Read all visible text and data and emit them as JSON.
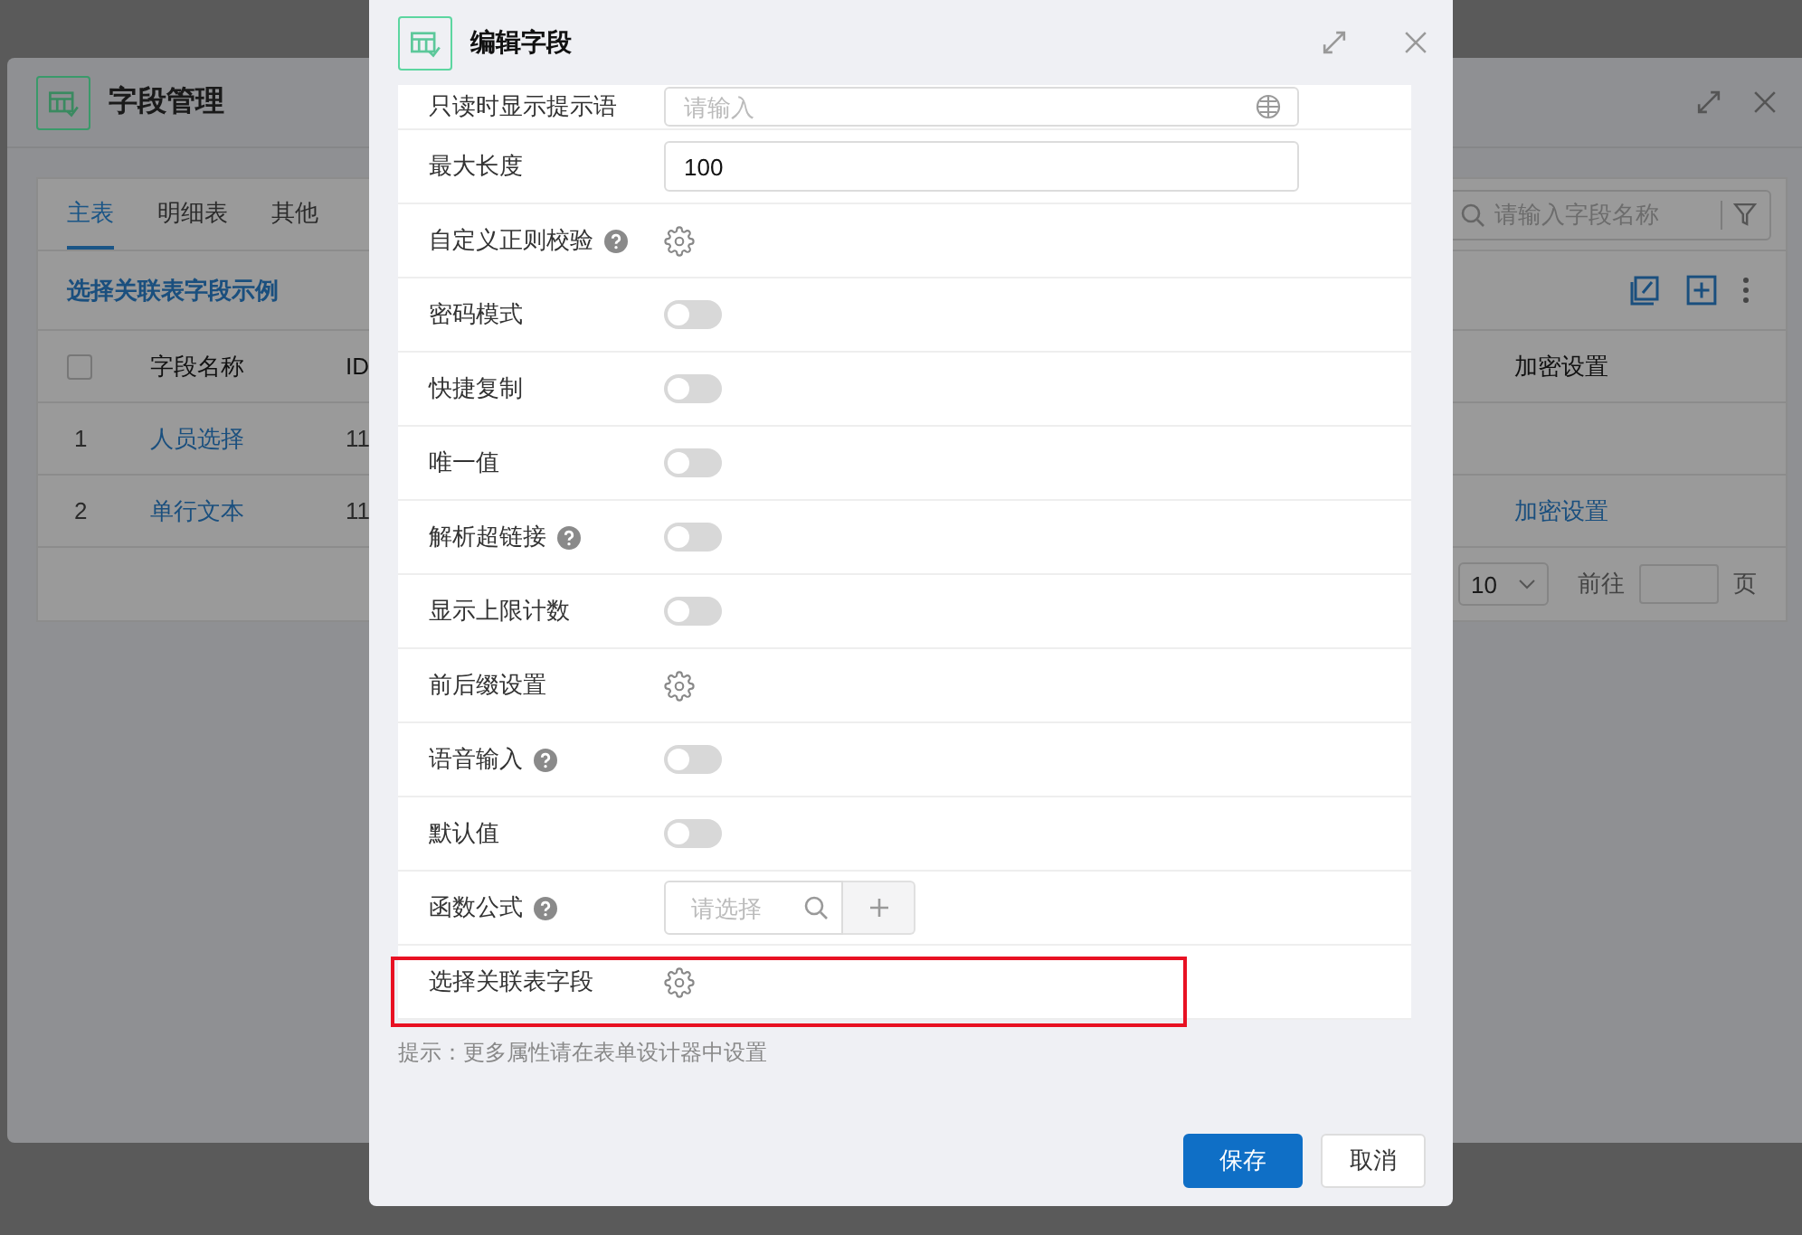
{
  "back_window": {
    "title": "字段管理",
    "tabs": [
      {
        "label": "主表",
        "selected": true
      },
      {
        "label": "明细表",
        "selected": false
      },
      {
        "label": "其他",
        "selected": false
      }
    ],
    "search": {
      "placeholder": "请输入字段名称"
    },
    "link": "选择关联表字段示例",
    "table": {
      "select_all": {
        "checked": false
      },
      "columns": [
        "字段名称",
        "ID",
        "加密设置"
      ],
      "rows": [
        {
          "index": "1",
          "name": "人员选择",
          "id": "11",
          "encrypt": ""
        },
        {
          "index": "2",
          "name": "单行文本",
          "id": "11",
          "encrypt": "加密设置"
        }
      ]
    },
    "pagination": {
      "page_size": "10",
      "goto_label": "前往",
      "page_unit": "页"
    }
  },
  "dialog": {
    "title": "编辑字段",
    "rows": [
      {
        "kind": "input",
        "label": "只读时显示提示语",
        "help": false,
        "placeholder": "请输入",
        "globe": true
      },
      {
        "kind": "input",
        "label": "最大长度",
        "help": false,
        "value": "100"
      },
      {
        "kind": "gear",
        "label": "自定义正则校验",
        "help": true
      },
      {
        "kind": "toggle",
        "label": "密码模式",
        "help": false,
        "on": false
      },
      {
        "kind": "toggle",
        "label": "快捷复制",
        "help": false,
        "on": false
      },
      {
        "kind": "toggle",
        "label": "唯一值",
        "help": false,
        "on": false
      },
      {
        "kind": "toggle",
        "label": "解析超链接",
        "help": true,
        "on": false
      },
      {
        "kind": "toggle",
        "label": "显示上限计数",
        "help": false,
        "on": false
      },
      {
        "kind": "gear",
        "label": "前后缀设置",
        "help": false
      },
      {
        "kind": "toggle",
        "label": "语音输入",
        "help": true,
        "on": false
      },
      {
        "kind": "toggle",
        "label": "默认值",
        "help": false,
        "on": false
      },
      {
        "kind": "select",
        "label": "函数公式",
        "help": true,
        "placeholder": "请选择"
      },
      {
        "kind": "gear",
        "label": "选择关联表字段",
        "help": false,
        "highlighted": true
      }
    ],
    "hint": "提示：更多属性请在表单设计器中设置",
    "buttons": [
      {
        "label": "保存",
        "primary": true
      },
      {
        "label": "取消",
        "primary": false
      }
    ]
  }
}
